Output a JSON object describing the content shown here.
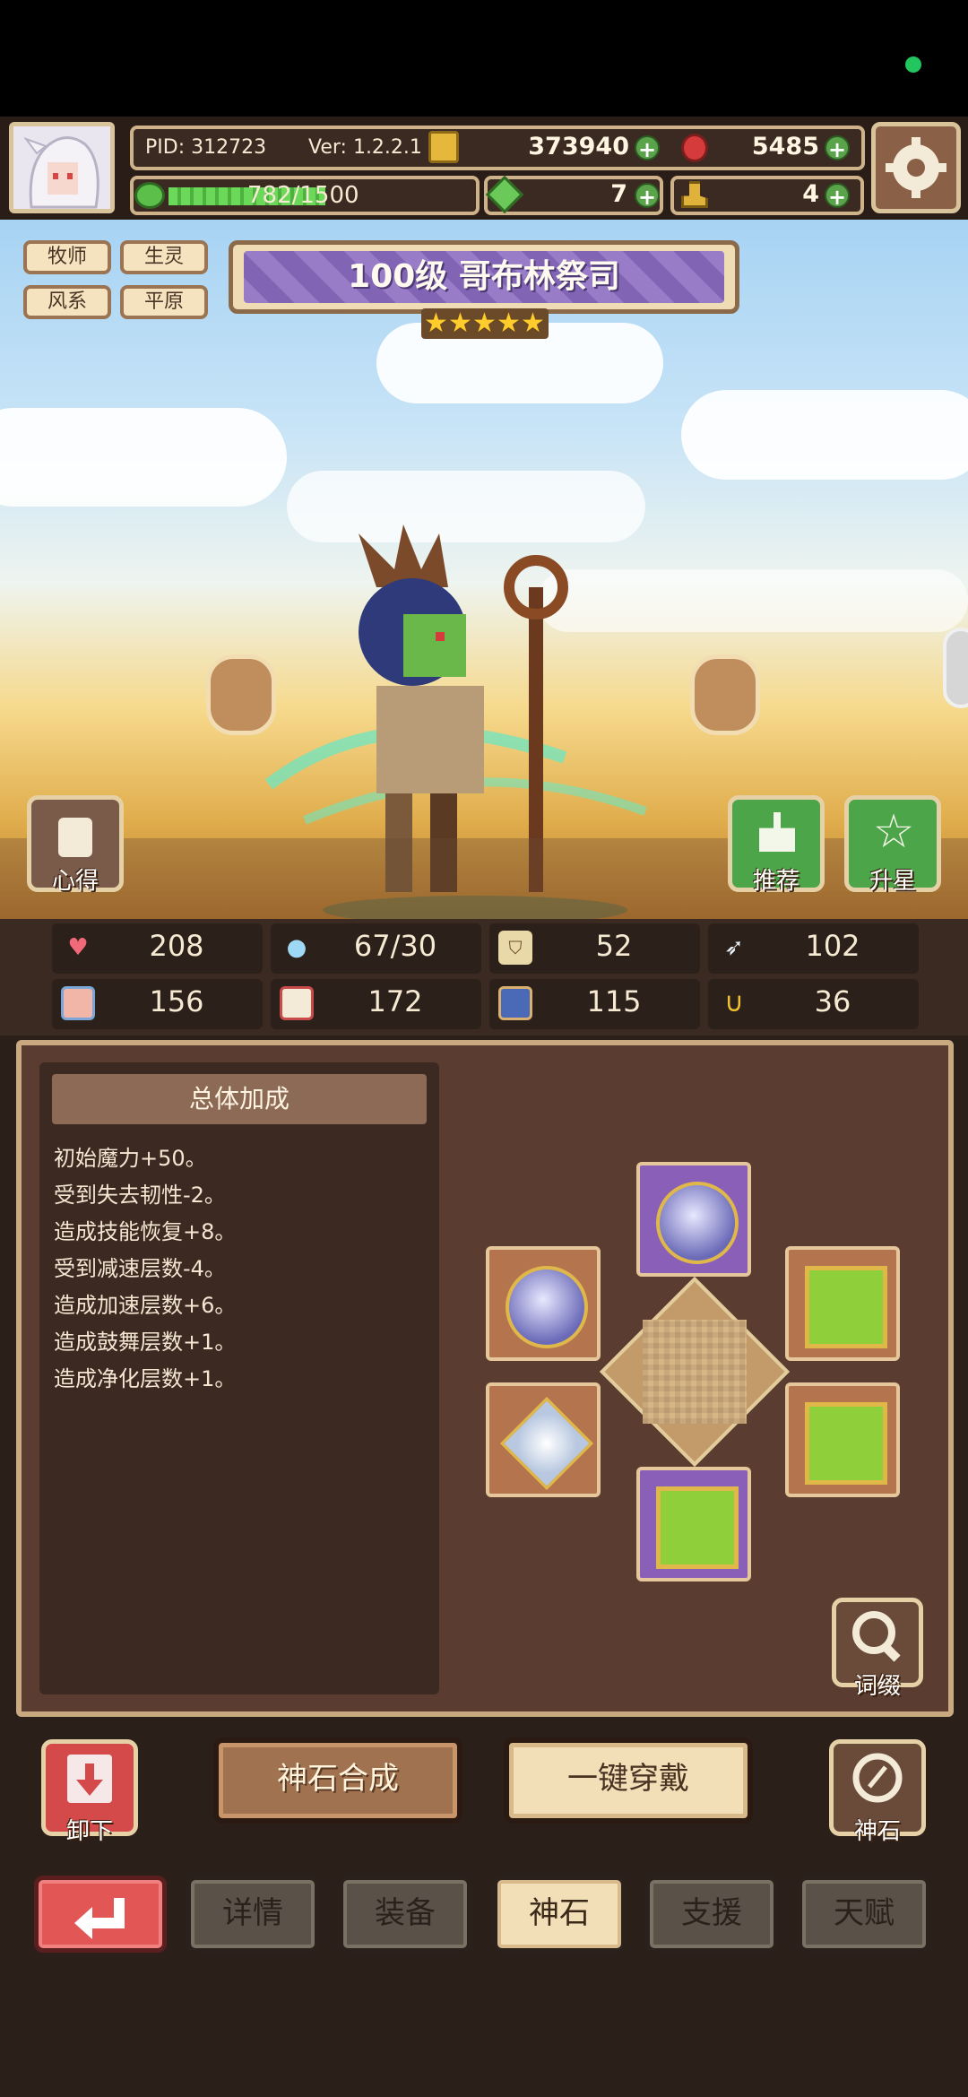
{
  "header": {
    "pid": "PID: 312723",
    "version": "Ver: 1.2.2.1",
    "exp": "782/1500",
    "exp_fraction": 0.521,
    "gold": "373940",
    "gem": "5485",
    "clover": "7",
    "boot": "4"
  },
  "hero": {
    "tags": [
      "牧师",
      "生灵",
      "风系",
      "平原"
    ],
    "title": "100级 哥布林祭司",
    "stars": 5
  },
  "side_buttons": {
    "insight": "心得",
    "recommend": "推荐",
    "star_up": "升星"
  },
  "stats": [
    "208",
    "67/30",
    "52",
    "102",
    "156",
    "172",
    "115",
    "36"
  ],
  "bonus": {
    "heading": "总体加成",
    "lines": [
      "初始魔力+50。",
      "受到失去韧性-2。",
      "造成技能恢复+8。",
      "受到减速层数-4。",
      "造成加速层数+6。",
      "造成鼓舞层数+1。",
      "造成净化层数+1。"
    ]
  },
  "buttons": {
    "affix": "词缀",
    "unload": "卸下",
    "synthesize": "神石合成",
    "one_click_equip": "一键穿戴",
    "gem": "神石"
  },
  "tabs": [
    "详情",
    "装备",
    "神石",
    "支援",
    "天赋"
  ],
  "active_tab": "神石",
  "colors": {
    "accent_purple": "#8a6ac0",
    "panel_brown": "#5a3d30",
    "gold": "#ffcc2e"
  }
}
